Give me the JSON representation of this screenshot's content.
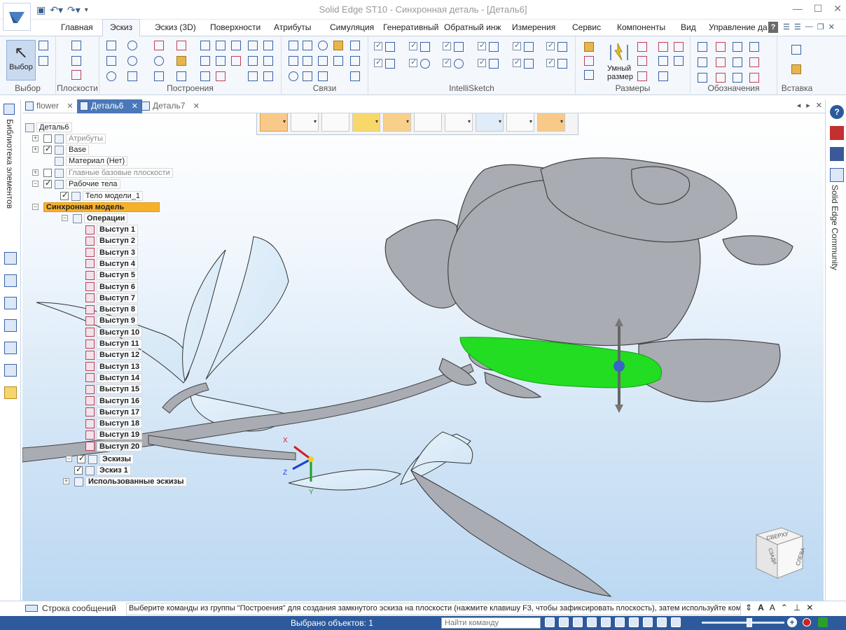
{
  "app": {
    "window_title": "Solid Edge ST10 - Синхронная деталь - [Деталь6]"
  },
  "ribbon_tabs": [
    "Главная",
    "Эскиз",
    "Эскиз (3D)",
    "Поверхности",
    "Атрибуты",
    "Симуляция",
    "Генеративный",
    "Обратный инж",
    "Измерения",
    "Сервис",
    "Компоненты",
    "Вид",
    "Управление да"
  ],
  "active_ribbon_tab": "Эскиз",
  "ribbon": {
    "select_label": "Выбор",
    "groups": {
      "select": "Выбор",
      "planes": "Плоскости",
      "draw": "Построения",
      "relate": "Связи",
      "intellisketch": "IntelliSketch",
      "dimension": "Размеры",
      "annotation": "Обозначения",
      "insert": "Вставка"
    },
    "smart_dimension_line1": "Умный",
    "smart_dimension_line2": "размер"
  },
  "document_tabs": [
    {
      "label": "flower",
      "active": false
    },
    {
      "label": "Деталь6",
      "active": true
    },
    {
      "label": "Деталь7",
      "active": false
    }
  ],
  "left_panel": {
    "library_label": "Библиотека элементов"
  },
  "right_panel": {
    "community_label": "Solid Edge Community"
  },
  "tree": {
    "root": "Деталь6",
    "attributes": "Атрибуты",
    "base": "Base",
    "material": "Материал (Нет)",
    "base_planes": "Главные базовые плоскости",
    "bodies": "Рабочие тела",
    "body1": "Тело модели_1",
    "sync_model": "Синхронная модель",
    "operations": "Операции",
    "features": [
      "Выступ 1",
      "Выступ 2",
      "Выступ 3",
      "Выступ 4",
      "Выступ 5",
      "Выступ 6",
      "Выступ 7",
      "Выступ 8",
      "Выступ 9",
      "Выступ 10",
      "Выступ 11",
      "Выступ 12",
      "Выступ 13",
      "Выступ 14",
      "Выступ 15",
      "Выступ 16",
      "Выступ 17",
      "Выступ 18",
      "Выступ 19",
      "Выступ 20"
    ],
    "sketches": "Эскизы",
    "sketch1": "Эскиз 1",
    "used_sketches": "Использованные эскизы"
  },
  "axis_labels": {
    "x": "X",
    "y": "Y",
    "z": "Z"
  },
  "view_cube": {
    "face_front": "СЛЕВА",
    "face_top": "СВЕРХУ",
    "face_side": "СЗАДИ"
  },
  "prompt": {
    "toggle_label": "Строка сообщений",
    "text": "Выберите команды из группы \"Построения\" для создания замкнутого эскиза на плоскости (нажмите клавишу F3, чтобы зафиксировать плоскость), затем используйте команды"
  },
  "status": {
    "selected": "Выбрано объектов: 1",
    "command_search_placeholder": "Найти команду"
  },
  "colors": {
    "accent": "#2d5a9c",
    "highlight": "#f6b12c",
    "selected_face": "#22dd22",
    "model_gray": "#a9acb2"
  }
}
